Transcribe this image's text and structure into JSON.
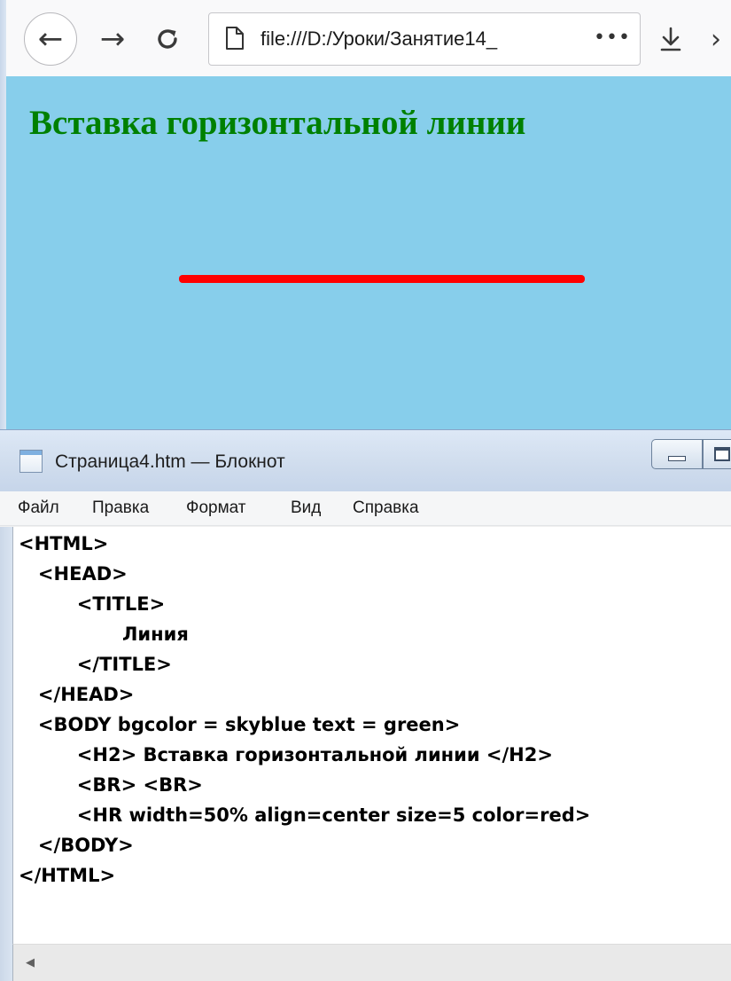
{
  "browser": {
    "url": "file:///D:/Уроки/Занятие14_",
    "url_more": "•••",
    "icons": {
      "back": "←",
      "forward": "→",
      "reload": "C",
      "download": "⭳",
      "overflow": "›"
    },
    "page": {
      "heading": "Вставка горизонтальной линии",
      "background_color": "#87ceeb",
      "text_color": "#008000",
      "line_color": "#ff0000",
      "line_width_percent": 50
    }
  },
  "notepad": {
    "title": "Страница4.htm — Блокнот",
    "menu": [
      "Файл",
      "Правка",
      "Формат",
      "Вид",
      "Справка"
    ],
    "code_lines": [
      "<HTML>",
      "   <HEAD>",
      "         <TITLE>",
      "                Линия",
      "         </TITLE>",
      "   </HEAD>",
      "   <BODY bgcolor = skyblue text = green>",
      "         <H2> Вставка горизонтальной линии </H2>",
      "         <BR> <BR>",
      "         <HR width=50% align=center size=5 color=red>",
      "   </BODY>",
      "</HTML>"
    ],
    "scroll_left_icon": "◀"
  }
}
